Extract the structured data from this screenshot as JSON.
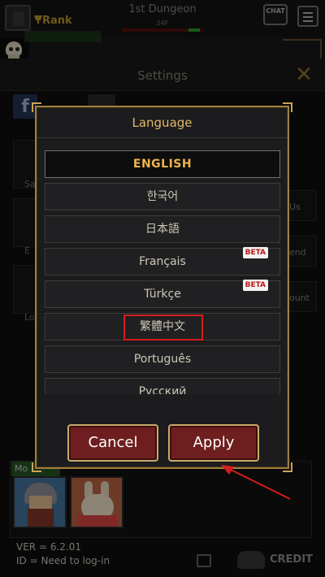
{
  "hud": {
    "rank_label": "Rank",
    "dungeon_title": "1st Dungeon",
    "dungeon_floor": "24F",
    "chat_label": "CHAT"
  },
  "settings": {
    "title": "Settings",
    "close_glyph": "✕",
    "facebook_glyph": "f",
    "left_buttons": [
      "Sa",
      "E",
      "Lo"
    ],
    "right_buttons": [
      "Us",
      "end",
      "ount"
    ],
    "monster_label": "Mo",
    "version": "VER = 6.2.01",
    "login_id": "ID = Need to log-in",
    "credit_label": "CREDIT"
  },
  "language_dialog": {
    "title": "Language",
    "languages": [
      {
        "label": "ENGLISH",
        "selected": true,
        "badge": ""
      },
      {
        "label": "한국어",
        "selected": false,
        "badge": ""
      },
      {
        "label": "日本語",
        "selected": false,
        "badge": ""
      },
      {
        "label": "Français",
        "selected": false,
        "badge": "BETA"
      },
      {
        "label": "Türkçe",
        "selected": false,
        "badge": "BETA"
      },
      {
        "label": "繁體中文",
        "selected": false,
        "badge": ""
      },
      {
        "label": "Português",
        "selected": false,
        "badge": ""
      },
      {
        "label": "Русский",
        "selected": false,
        "badge": ""
      }
    ],
    "cancel_label": "Cancel",
    "apply_label": "Apply"
  },
  "colors": {
    "accent_gold": "#e2b968",
    "button_red": "#6e1e1e",
    "annotation_red": "#d51d1d",
    "beta_text": "#b71b1b"
  },
  "icons": [
    "player-portrait-icon",
    "trophy-icon",
    "chat-icon",
    "menu-icon",
    "skull-icon",
    "close-icon",
    "facebook-icon",
    "copy-icon",
    "credit-icon"
  ]
}
